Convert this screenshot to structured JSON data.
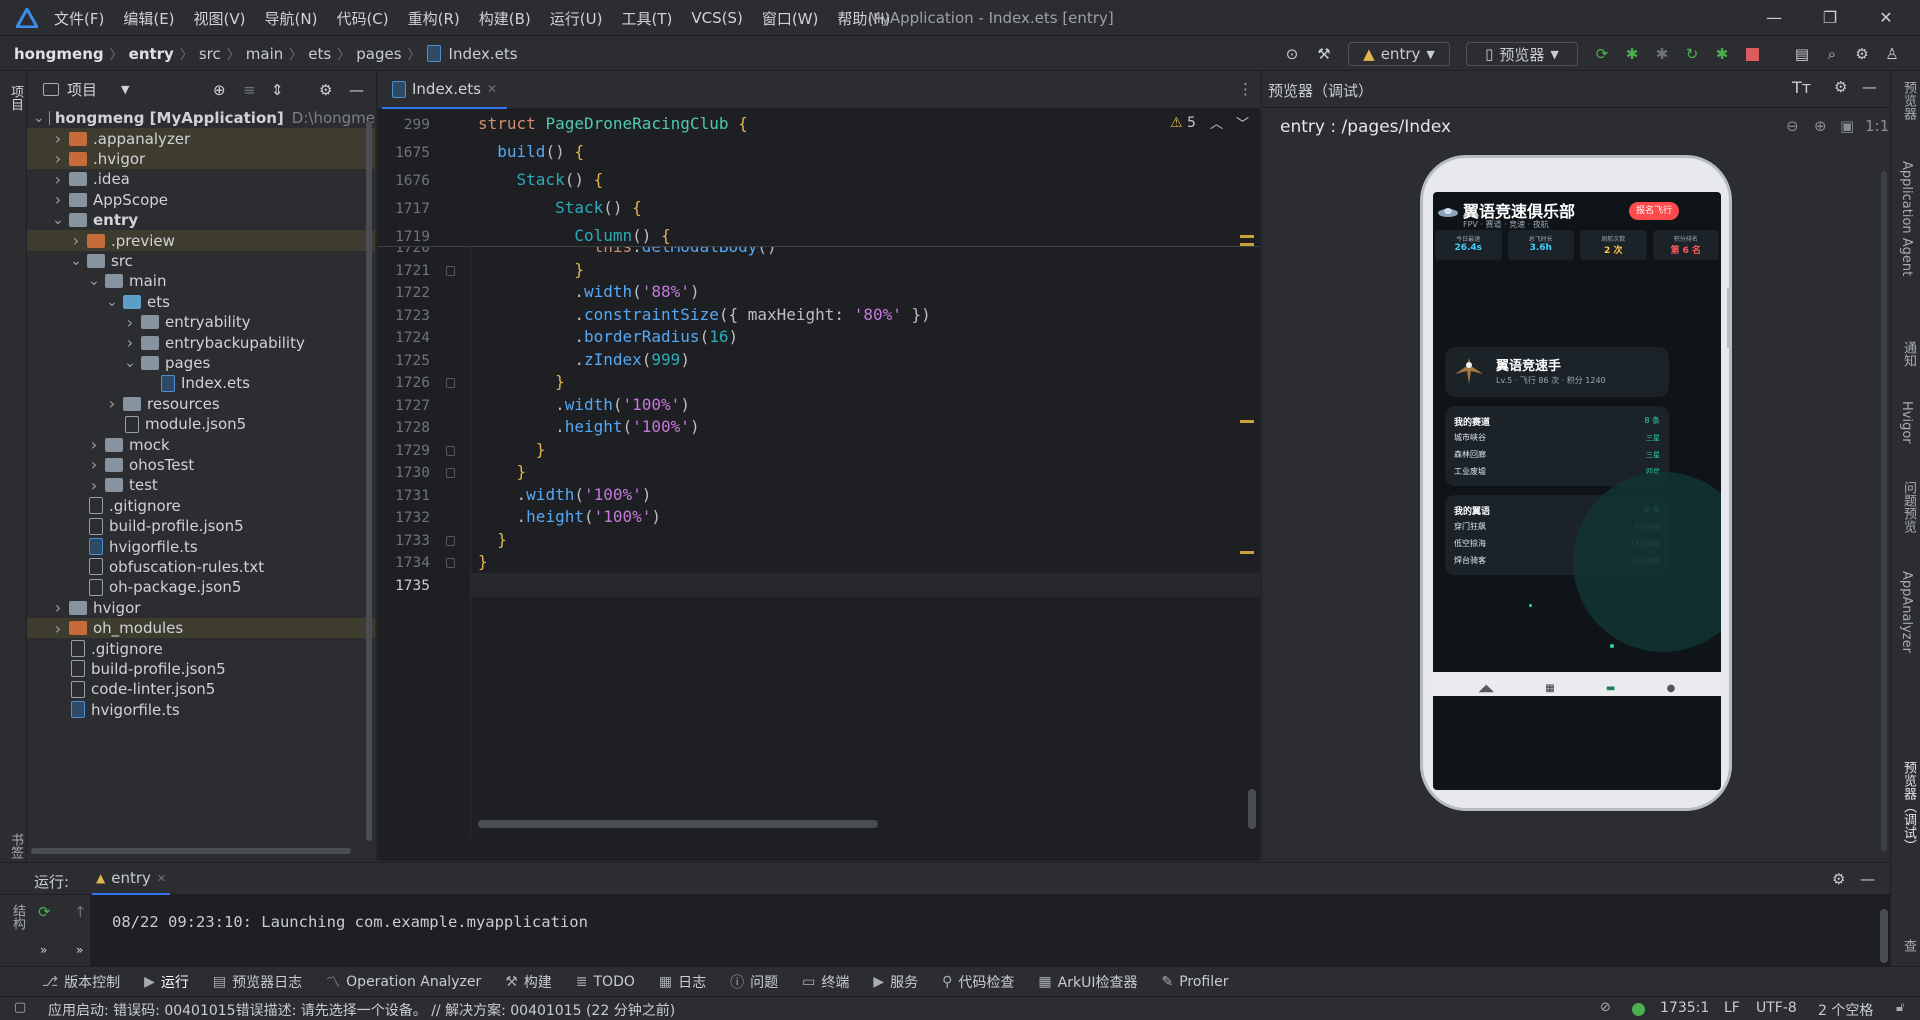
{
  "menu": [
    "文件(F)",
    "编辑(E)",
    "视图(V)",
    "导航(N)",
    "代码(C)",
    "重构(R)",
    "构建(B)",
    "运行(U)",
    "工具(T)",
    "VCS(S)",
    "窗口(W)",
    "帮助(H)"
  ],
  "window_title": "MyApplication - Index.ets [entry]",
  "breadcrumbs": [
    "hongmeng",
    "entry",
    "src",
    "main",
    "ets",
    "pages",
    "Index.ets"
  ],
  "toolbar": {
    "run_config": "entry",
    "previewer": "预览器"
  },
  "left_stripe": {
    "project": "项目",
    "bookmarks": "书签",
    "structure": "结构"
  },
  "project_panel": {
    "title": "项目",
    "tree": [
      {
        "label": "hongmeng [MyApplication]",
        "suffix": "D:\\hongme",
        "icon": "module",
        "depth": 0,
        "arrow": "down"
      },
      {
        "label": ".appanalyzer",
        "icon": "orange",
        "depth": 1,
        "arrow": "right",
        "hl": true
      },
      {
        "label": ".hvigor",
        "icon": "orange",
        "depth": 1,
        "arrow": "right",
        "hl": true
      },
      {
        "label": ".idea",
        "icon": "blue",
        "depth": 1,
        "arrow": "right"
      },
      {
        "label": "AppScope",
        "icon": "blue",
        "depth": 1,
        "arrow": "right"
      },
      {
        "label": "entry",
        "icon": "module",
        "depth": 1,
        "arrow": "down",
        "bold": true
      },
      {
        "label": ".preview",
        "icon": "orange",
        "depth": 2,
        "arrow": "right",
        "hl": true
      },
      {
        "label": "src",
        "icon": "blue",
        "depth": 2,
        "arrow": "down"
      },
      {
        "label": "main",
        "icon": "blue",
        "depth": 3,
        "arrow": "down"
      },
      {
        "label": "ets",
        "icon": "pkg",
        "depth": 4,
        "arrow": "down"
      },
      {
        "label": "entryability",
        "icon": "blue",
        "depth": 5,
        "arrow": "right"
      },
      {
        "label": "entrybackupability",
        "icon": "blue",
        "depth": 5,
        "arrow": "right"
      },
      {
        "label": "pages",
        "icon": "blue",
        "depth": 5,
        "arrow": "down"
      },
      {
        "label": "Index.ets",
        "icon": "ets",
        "depth": 6,
        "arrow": ""
      },
      {
        "label": "resources",
        "icon": "blue",
        "depth": 4,
        "arrow": "right"
      },
      {
        "label": "module.json5",
        "icon": "file",
        "depth": 4,
        "arrow": ""
      },
      {
        "label": "mock",
        "icon": "blue",
        "depth": 3,
        "arrow": "right"
      },
      {
        "label": "ohosTest",
        "icon": "blue",
        "depth": 3,
        "arrow": "right"
      },
      {
        "label": "test",
        "icon": "blue",
        "depth": 3,
        "arrow": "right"
      },
      {
        "label": ".gitignore",
        "icon": "file",
        "depth": 2,
        "arrow": ""
      },
      {
        "label": "build-profile.json5",
        "icon": "file",
        "depth": 2,
        "arrow": ""
      },
      {
        "label": "hvigorfile.ts",
        "icon": "ts",
        "depth": 2,
        "arrow": ""
      },
      {
        "label": "obfuscation-rules.txt",
        "icon": "file",
        "depth": 2,
        "arrow": ""
      },
      {
        "label": "oh-package.json5",
        "icon": "file",
        "depth": 2,
        "arrow": ""
      },
      {
        "label": "hvigor",
        "icon": "blue",
        "depth": 1,
        "arrow": "right"
      },
      {
        "label": "oh_modules",
        "icon": "orange",
        "depth": 1,
        "arrow": "right",
        "hl": true
      },
      {
        "label": ".gitignore",
        "icon": "file",
        "depth": 1,
        "arrow": ""
      },
      {
        "label": "build-profile.json5",
        "icon": "file",
        "depth": 1,
        "arrow": ""
      },
      {
        "label": "code-linter.json5",
        "icon": "file",
        "depth": 1,
        "arrow": ""
      },
      {
        "label": "hvigorfile.ts",
        "icon": "ts",
        "depth": 1,
        "arrow": ""
      }
    ]
  },
  "editor": {
    "tab": "Index.ets",
    "warnings": "5",
    "sticky_lines": [
      "299",
      "1675",
      "1676",
      "1717",
      "1719"
    ],
    "lines": [
      "1720",
      "1721",
      "1722",
      "1723",
      "1724",
      "1725",
      "1726",
      "1727",
      "1728",
      "1729",
      "1730",
      "1731",
      "1732",
      "1733",
      "1734",
      "1735"
    ]
  },
  "preview_panel": {
    "title": "预览器（调试）",
    "route": "entry : /pages/Index",
    "ratio": "1:1"
  },
  "app": {
    "title": "翼语竞速俱乐部",
    "subtitle": "FPV · 赛道 · 竞速 · 夜航",
    "join": "报名飞行",
    "stats": [
      {
        "label": "今日最速",
        "value": "26.4s",
        "color": "#3fd0ff"
      },
      {
        "label": "总飞时长",
        "value": "3.6h",
        "color": "#3fd0ff"
      },
      {
        "label": "周航次数",
        "value": "2 次",
        "color": "#ffc83d"
      },
      {
        "label": "积分排名",
        "value": "第 6 名",
        "color": "#ff5a5a"
      }
    ],
    "profile_name": "翼语竞速手",
    "profile_meta": "Lv.5 · 飞行 86 次 · 积分 1240",
    "tracks_title": "我的赛道",
    "tracks_count": "8 条",
    "tracks": [
      {
        "name": "城市峡谷",
        "tag": "三星"
      },
      {
        "name": "森林回廊",
        "tag": "三星"
      },
      {
        "name": "工业废墟",
        "tag": "四星"
      }
    ],
    "feed_title": "我的翼语",
    "feed_count": "8 条",
    "feed": [
      {
        "name": "穿门狂飙",
        "time": "3分钟前"
      },
      {
        "name": "低空掠海",
        "time": "17分钟前"
      },
      {
        "name": "焊台骑客",
        "time": "32分钟前"
      }
    ]
  },
  "run_panel": {
    "label": "运行:",
    "tab": "entry",
    "log": "08/22 09:23:10: Launching com.example.myapplication"
  },
  "bottom_tools": [
    "版本控制",
    "运行",
    "预览器日志",
    "Operation Analyzer",
    "构建",
    "TODO",
    "日志",
    "问题",
    "终端",
    "服务",
    "代码检查",
    "ArkUI检查器",
    "Profiler"
  ],
  "right_stripe": [
    "预览器",
    "Application Agent",
    "通知",
    "Hvigor",
    "问题预览",
    "AppAnalyzer",
    "预览器（调试）",
    "数据库检查"
  ],
  "status": {
    "message": "应用启动: 错误码: 00401015错误描述: 请先选择一个设备。 // 解决方案: 00401015 (22 分钟之前)",
    "position": "1735:1",
    "line_sep": "LF",
    "encoding": "UTF-8",
    "indent": "2 个空格"
  }
}
